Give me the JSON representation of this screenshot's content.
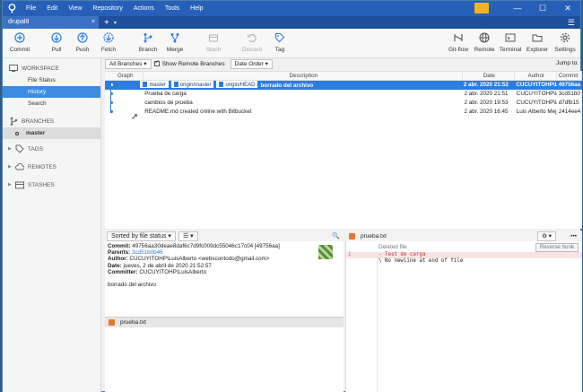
{
  "window": {
    "menu": [
      "File",
      "Edit",
      "View",
      "Repository",
      "Actions",
      "Tools",
      "Help"
    ],
    "controls": {
      "minimize": "—",
      "maximize": "☐",
      "close": "✕"
    },
    "accent": "#2760b8"
  },
  "tabs": {
    "active": "drupal8",
    "close": "×",
    "new": "+",
    "more": "▾"
  },
  "toolbar": {
    "commit": "Commit",
    "pull": "Pull",
    "push": "Push",
    "fetch": "Fetch",
    "branch": "Branch",
    "merge": "Merge",
    "stash": "Stash",
    "discard": "Discard",
    "tag": "Tag",
    "gitflow": "Git-flow",
    "remote": "Remote",
    "terminal": "Terminal",
    "explorer": "Explorer",
    "settings": "Settings"
  },
  "sidebar": {
    "workspace": "WORKSPACE",
    "file_status": "File Status",
    "history": "History",
    "search": "Search",
    "branches": "BRANCHES",
    "master": "master",
    "tags": "TAGS",
    "remotes": "REMOTES",
    "stashes": "STASHES"
  },
  "filter": {
    "all_branches": "All Branches ▾",
    "show_remote": "Show Remote Branches",
    "order": "Date Order ▾",
    "jump": "Jump to:"
  },
  "table": {
    "headers": {
      "graph": "Graph",
      "description": "Description",
      "date": "Date",
      "author": "Author",
      "commit": "Commit"
    },
    "rows": [
      {
        "tags": [
          "master",
          "origin/master",
          "origin/HEAD"
        ],
        "desc": "borrado del archivo",
        "date": "2 abr. 2020 21:52",
        "author": "CUCUYITOHP\\Luis",
        "commit": "49756aa"
      },
      {
        "desc": "Prueba de carga",
        "date": "2 abr. 2020 21:51",
        "author": "CUCUYITOHP\\Luis",
        "commit": "3cd51b0"
      },
      {
        "desc": "cambios de prueba",
        "date": "2 abr. 2020 19:53",
        "author": "CUCUYITOHP\\Luis",
        "commit": "d7dfb15"
      },
      {
        "desc": "README.md created online with Bitbucket",
        "date": "2 abr. 2020 16:45",
        "author": "Luis Alberto Mejia",
        "commit": "2414ee4"
      }
    ]
  },
  "details": {
    "sort": "Sorted by file status ▾",
    "view": "☰ ▾",
    "commit_label": "Commit:",
    "commit_value": "49756aa30deae8daf6c7d9fc009dc55046c17c04 [49756aa]",
    "parents_label": "Parents:",
    "parents_value": "3cd51b0b46",
    "author_label": "Author:",
    "author_value": "CUCUYITOHP\\LuisAlberto <webscontodo@gmail.com>",
    "date_label": "Date:",
    "date_value": "jueves, 2 de abril de 2020 21:52:57",
    "committer_label": "Committer:",
    "committer_value": "CUCUYITOHP\\LuisAlberto",
    "message": "borrado del archivo",
    "file": "prueba.txt"
  },
  "diff": {
    "file": "prueba.txt",
    "deleted": "Deleted file",
    "reverse": "Reverse hunk",
    "gear": "⚙ ▾",
    "more": "•••",
    "lines": [
      {
        "num": "1",
        "text": "- Test de carga"
      },
      {
        "num": "",
        "text": "\\ No newline at end of file"
      }
    ]
  }
}
